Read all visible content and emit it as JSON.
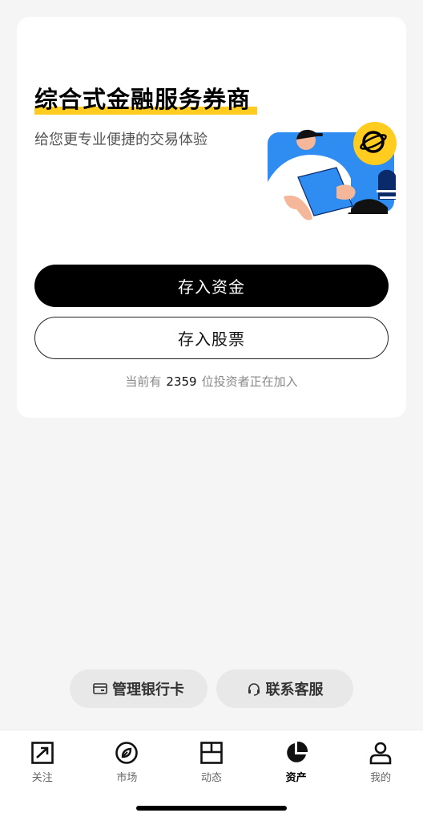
{
  "hero": {
    "title": "综合式金融服务券商",
    "subtitle": "给您更专业便捷的交易体验",
    "deposit_funds_label": "存入资金",
    "deposit_stocks_label": "存入股票",
    "joiners_prefix": "当前有",
    "joiners_count": "2359",
    "joiners_suffix": "位投资者正在加入"
  },
  "actions": {
    "manage_bank_card": "管理银行卡",
    "contact_service": "联系客服"
  },
  "tabbar": {
    "items": [
      {
        "label": "关注",
        "icon": "trend-chart-icon",
        "active": false
      },
      {
        "label": "市场",
        "icon": "compass-leaf-icon",
        "active": false
      },
      {
        "label": "动态",
        "icon": "layout-grid-icon",
        "active": false
      },
      {
        "label": "资产",
        "icon": "pie-chart-icon",
        "active": true
      },
      {
        "label": "我的",
        "icon": "person-icon",
        "active": false
      }
    ]
  },
  "colors": {
    "accent_yellow": "#ffcc1f",
    "illustration_blue": "#2f8cf0",
    "primary_button": "#000000"
  }
}
